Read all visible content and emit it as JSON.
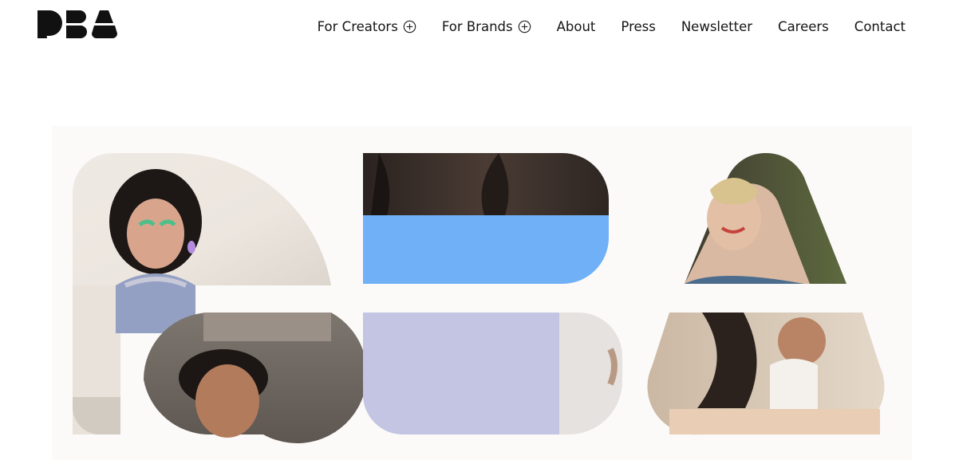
{
  "brand": {
    "logo_alt": "DBA",
    "logo_icon": "dba-logo"
  },
  "nav": {
    "items": [
      {
        "label": "For Creators",
        "icon": "plus-circle-icon",
        "has_submenu": true
      },
      {
        "label": "For Brands",
        "icon": "plus-circle-icon",
        "has_submenu": true
      },
      {
        "label": "About",
        "has_submenu": false
      },
      {
        "label": "Press",
        "has_submenu": false
      },
      {
        "label": "Newsletter",
        "has_submenu": false
      },
      {
        "label": "Careers",
        "has_submenu": false
      },
      {
        "label": "Contact",
        "has_submenu": false
      }
    ]
  },
  "hero": {
    "graphic": "dba-letterform-photo-collage",
    "colors": {
      "blue_block": "#6fb0f7",
      "lavender_block": "#c3c5e2",
      "background": "#fbfaf9"
    }
  }
}
